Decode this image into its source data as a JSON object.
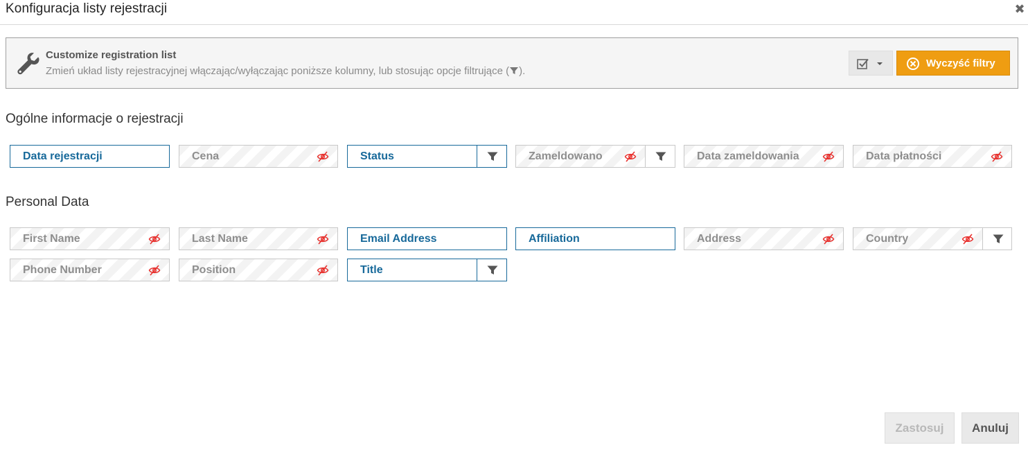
{
  "dialog": {
    "title": "Konfiguracja listy rejestracji",
    "close_icon": "close-icon"
  },
  "info": {
    "icon": "wrench-icon",
    "title": "Customize registration list",
    "description_before": "Zmień układ listy rejestracyjnej włączając/wyłączając poniższe kolumny, lub stosując opcje filtrujące (",
    "description_after": ").",
    "clear_filters_label": "Wyczyść filtry",
    "clear_color": "#ef9d12"
  },
  "sections": {
    "general": {
      "title": "Ogólne informacje o rejestracji",
      "items": [
        {
          "label": "Data rejestracji",
          "enabled": true,
          "filter": false
        },
        {
          "label": "Cena",
          "enabled": false,
          "filter": false
        },
        {
          "label": "Status",
          "enabled": true,
          "filter": true
        },
        {
          "label": "Zameldowano",
          "enabled": false,
          "filter": true
        },
        {
          "label": "Data zameldowania",
          "enabled": false,
          "filter": false
        },
        {
          "label": "Data płatności",
          "enabled": false,
          "filter": false
        }
      ]
    },
    "personal": {
      "title": "Personal Data",
      "items": [
        {
          "label": "First Name",
          "enabled": false,
          "filter": false
        },
        {
          "label": "Last Name",
          "enabled": false,
          "filter": false
        },
        {
          "label": "Email Address",
          "enabled": true,
          "filter": false
        },
        {
          "label": "Affiliation",
          "enabled": true,
          "filter": false
        },
        {
          "label": "Address",
          "enabled": false,
          "filter": false
        },
        {
          "label": "Country",
          "enabled": false,
          "filter": true
        },
        {
          "label": "Phone Number",
          "enabled": false,
          "filter": false
        },
        {
          "label": "Position",
          "enabled": false,
          "filter": false
        },
        {
          "label": "Title",
          "enabled": true,
          "filter": true
        }
      ]
    }
  },
  "footer": {
    "apply_label": "Zastosuj",
    "cancel_label": "Anuluj"
  },
  "colors": {
    "active_blue": "#17699a",
    "hidden_red": "#e8322f"
  }
}
